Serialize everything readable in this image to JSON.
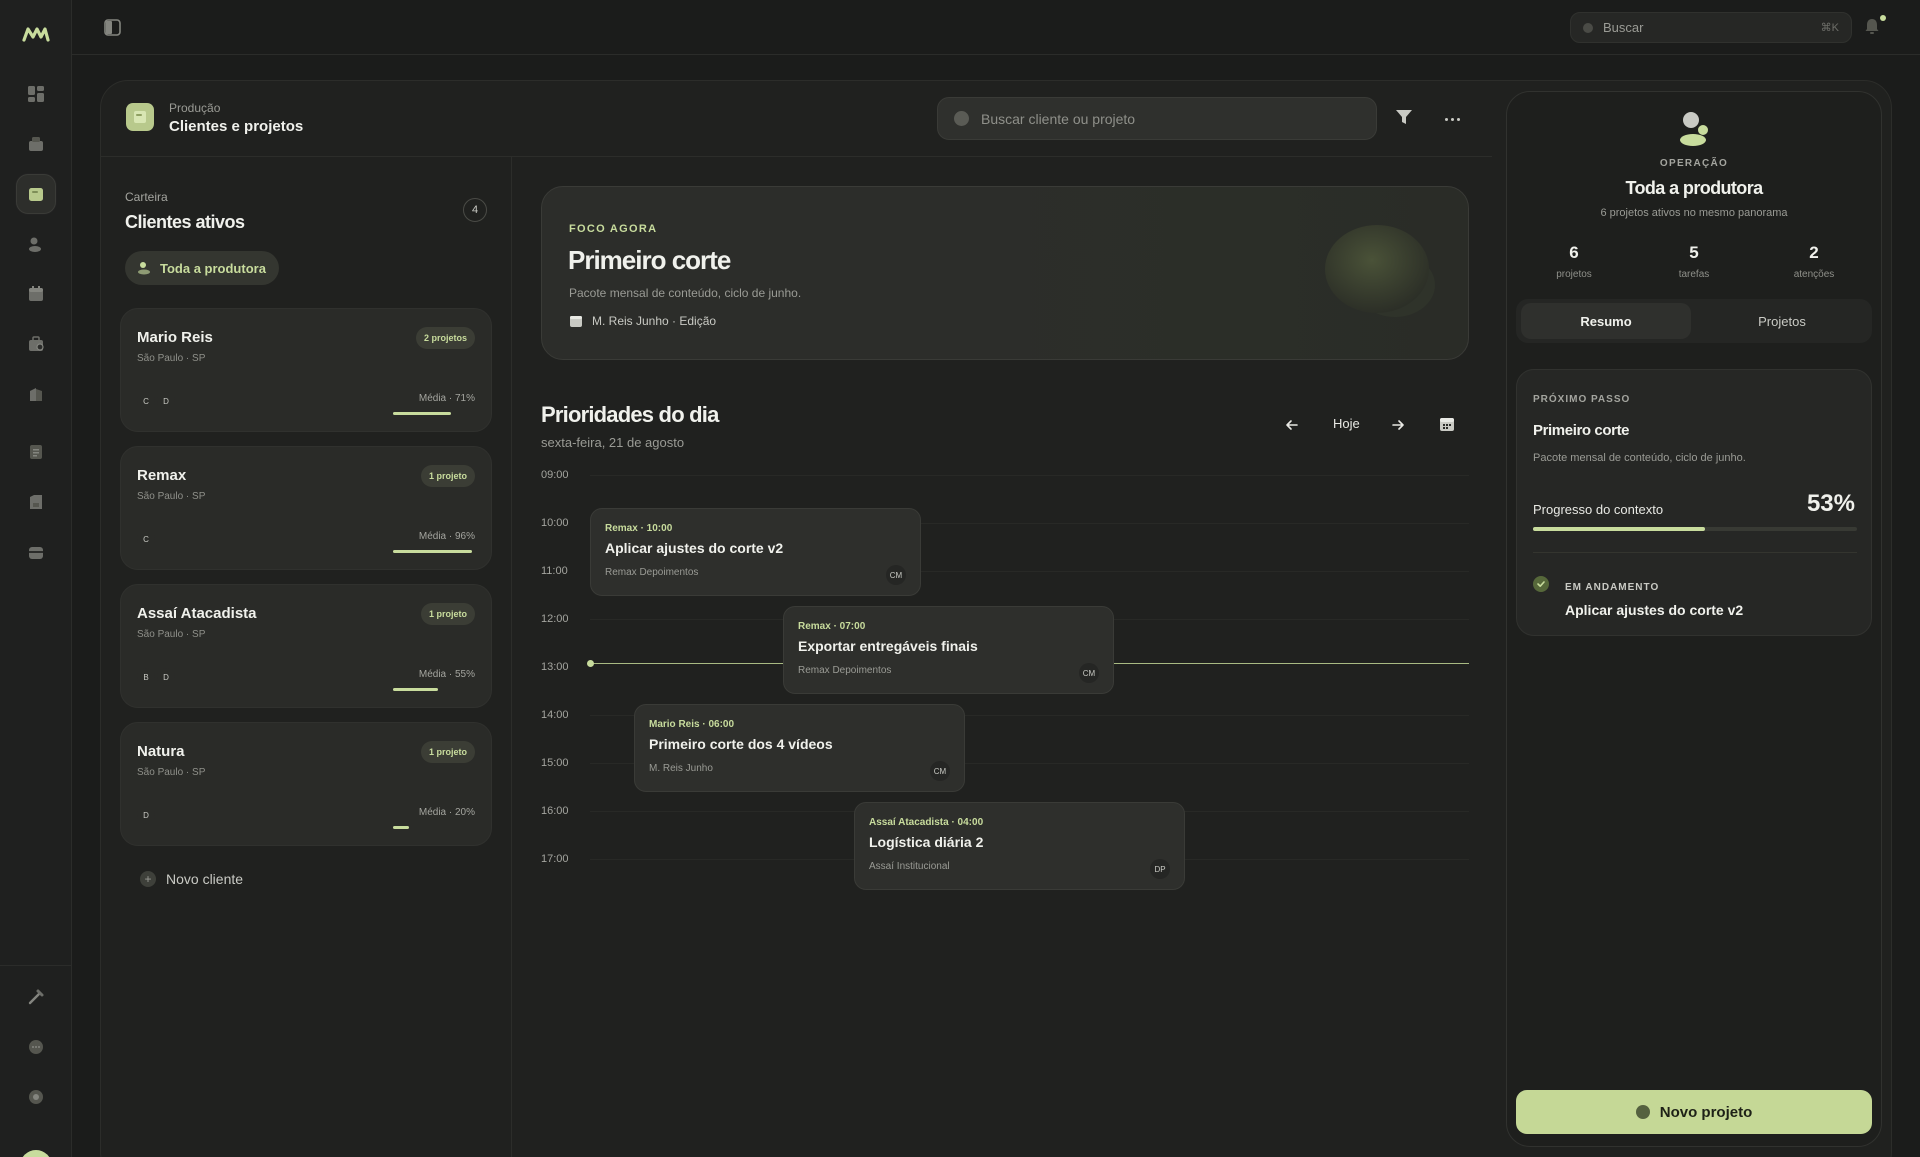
{
  "app": {
    "logo": "m",
    "sidebar_toggle_icon": "sidebar-toggle-icon"
  },
  "global_search": {
    "placeholder": "Buscar",
    "shortcut": "⌘K"
  },
  "nav": [
    "dashboard-icon",
    "package-icon",
    "folder-icon",
    "users-icon",
    "calendar-icon",
    "briefcase-icon",
    "building-icon",
    "document-icon",
    "report-icon",
    "archive-icon"
  ],
  "nav_bottom": [
    "tools-icon",
    "chat-icon",
    "settings-icon"
  ],
  "page": {
    "breadcrumb": "Produção",
    "title": "Clientes e projetos",
    "search_placeholder": "Buscar cliente ou projeto"
  },
  "clients": {
    "label": "Carteira",
    "title": "Clientes ativos",
    "count": "4",
    "all_filter": "Toda a produtora",
    "new_client": "Novo cliente",
    "items": [
      {
        "name": "Mario Reis",
        "location": "São Paulo · SP",
        "badge": "2 projetos",
        "avatars": [
          "C",
          "D"
        ],
        "media": "Média · 71%",
        "progress": 0.71
      },
      {
        "name": "Remax",
        "location": "São Paulo · SP",
        "badge": "1 projeto",
        "avatars": [
          "C"
        ],
        "media": "Média · 96%",
        "progress": 0.96
      },
      {
        "name": "Assaí Atacadista",
        "location": "São Paulo · SP",
        "badge": "1 projeto",
        "avatars": [
          "B",
          "D"
        ],
        "media": "Média · 55%",
        "progress": 0.55
      },
      {
        "name": "Natura",
        "location": "São Paulo · SP",
        "badge": "1 projeto",
        "avatars": [
          "D"
        ],
        "media": "Média · 20%",
        "progress": 0.2
      }
    ]
  },
  "focus": {
    "kicker": "FOCO AGORA",
    "title": "Primeiro corte",
    "description": "Pacote mensal de conteúdo, ciclo de junho.",
    "meta": "M. Reis Junho · Edição"
  },
  "schedule": {
    "title": "Prioridades do dia",
    "date": "sexta-feira, 21 de agosto",
    "today_label": "Hoje",
    "hours": [
      "09:00",
      "10:00",
      "11:00",
      "12:00",
      "13:00",
      "14:00",
      "15:00",
      "16:00",
      "17:00"
    ],
    "events": [
      {
        "tag": "Remax · 10:00",
        "title": "Aplicar ajustes do corte v2",
        "project": "Remax Depoimentos",
        "assignee": "CM"
      },
      {
        "tag": "Remax · 07:00",
        "title": "Exportar entregáveis finais",
        "project": "Remax Depoimentos",
        "assignee": "CM"
      },
      {
        "tag": "Mario Reis · 06:00",
        "title": "Primeiro corte dos 4 vídeos",
        "project": "M. Reis Junho",
        "assignee": "CM"
      },
      {
        "tag": "Assaí Atacadista · 04:00",
        "title": "Logística diária 2",
        "project": "Assaí Institucional",
        "assignee": "DP"
      }
    ]
  },
  "overview": {
    "kicker": "OPERAÇÃO",
    "title": "Toda a produtora",
    "subtitle": "6 projetos ativos no mesmo panorama",
    "stats": [
      {
        "value": "6",
        "label": "projetos"
      },
      {
        "value": "5",
        "label": "tarefas"
      },
      {
        "value": "2",
        "label": "atenções"
      }
    ],
    "tabs": [
      "Resumo",
      "Projetos"
    ],
    "next_step": {
      "kicker": "PRÓXIMO PASSO",
      "title": "Primeiro corte",
      "description": "Pacote mensal de conteúdo, ciclo de junho.",
      "progress_label": "Progresso do contexto",
      "progress_text": "53%",
      "progress": 0.53,
      "status_kicker": "EM ANDAMENTO",
      "status_task": "Aplicar ajustes do corte v2"
    },
    "new_project": "Novo projeto"
  },
  "colors": {
    "accent": "#c8dc9d",
    "bg": "#1b1c1b",
    "card": "#2a2b28"
  }
}
